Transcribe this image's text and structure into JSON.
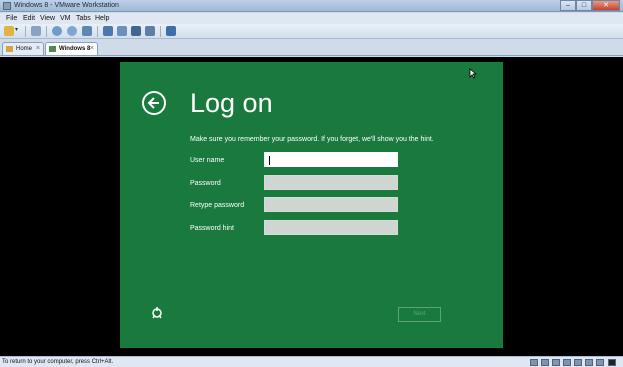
{
  "window": {
    "title": "Windows 8 - VMware Workstation"
  },
  "menu": [
    "File",
    "Edit",
    "View",
    "VM",
    "Tabs",
    "Help"
  ],
  "tabs": [
    {
      "label": "Home",
      "close": "×"
    },
    {
      "label": "Windows 8",
      "close": "×"
    }
  ],
  "logon": {
    "heading": "Log on",
    "instruction": "Make sure you remember your password. If you forget, we'll show you the hint.",
    "fields": [
      {
        "label": "User name",
        "value": ""
      },
      {
        "label": "Password",
        "value": ""
      },
      {
        "label": "Retype password",
        "value": ""
      },
      {
        "label": "Password hint",
        "value": ""
      }
    ],
    "next_label": "Next"
  },
  "status": {
    "text": "To return to your computer, press Ctrl+Alt."
  },
  "colors": {
    "screen_bg": "#1a7a3d",
    "title_bar": "#9fb9d6"
  },
  "icons": [
    "back-arrow-icon",
    "ease-of-access-icon",
    "mouse-cursor-icon",
    "home-icon",
    "vm-icon"
  ]
}
